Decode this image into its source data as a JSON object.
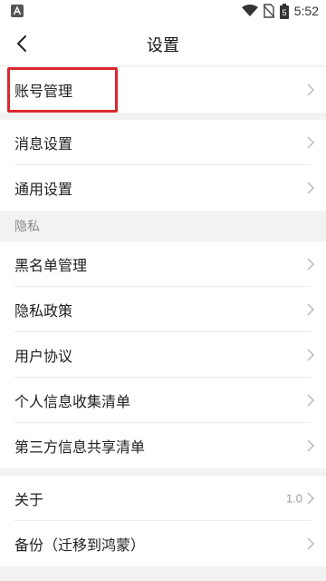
{
  "status_bar": {
    "left_icon": "a-notification-icon",
    "time": "5:52",
    "icons": [
      "wifi-icon",
      "no-sim-icon",
      "battery-icon"
    ],
    "battery_level": "5"
  },
  "header": {
    "title": "设置",
    "back_icon": "chevron-left-icon"
  },
  "groups": {
    "account": [
      {
        "label": "账号管理"
      }
    ],
    "general": [
      {
        "label": "消息设置"
      },
      {
        "label": "通用设置"
      }
    ],
    "privacy_header": "隐私",
    "privacy": [
      {
        "label": "黑名单管理"
      },
      {
        "label": "隐私政策"
      },
      {
        "label": "用户协议"
      },
      {
        "label": "个人信息收集清单"
      },
      {
        "label": "第三方信息共享清单"
      }
    ],
    "about": [
      {
        "label": "关于",
        "value": "1.0"
      },
      {
        "label": "备份（迁移到鸿蒙）"
      }
    ]
  },
  "highlight_color": "#d9292f"
}
